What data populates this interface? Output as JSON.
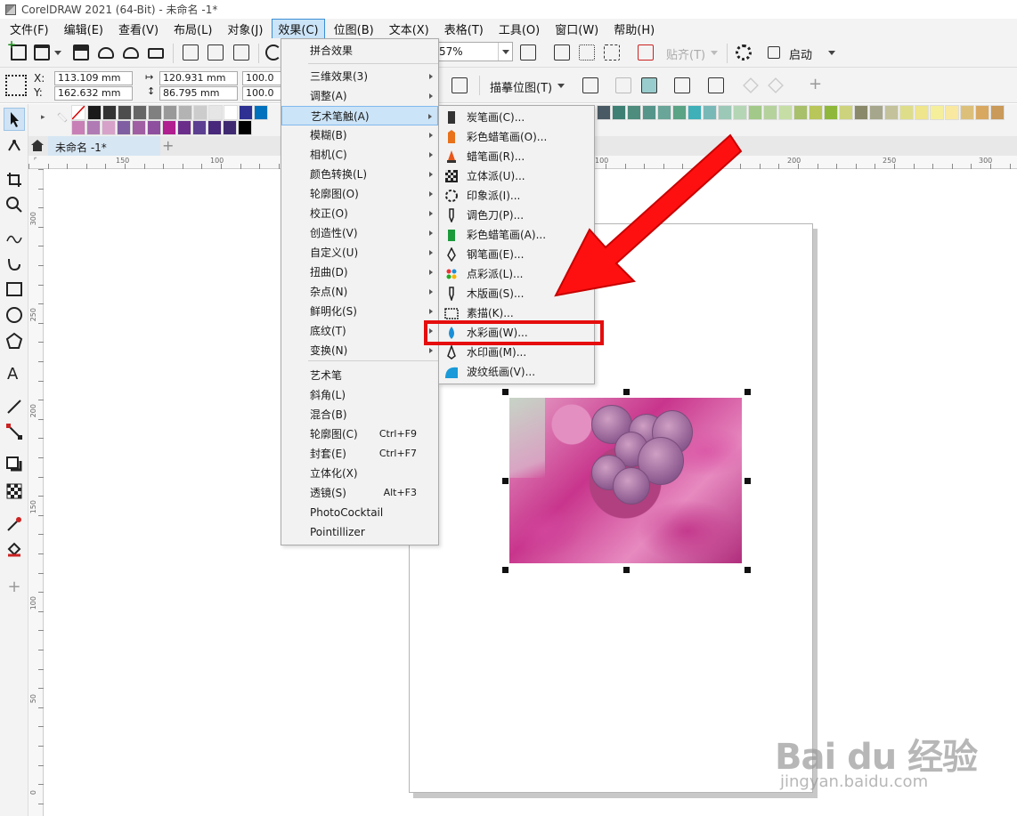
{
  "window": {
    "title": "CorelDRAW 2021 (64-Bit) - 未命名 -1*"
  },
  "menubar": {
    "items": [
      "文件(F)",
      "编辑(E)",
      "查看(V)",
      "布局(L)",
      "对象(J)",
      "效果(C)",
      "位图(B)",
      "文本(X)",
      "表格(T)",
      "工具(O)",
      "窗口(W)",
      "帮助(H)"
    ],
    "active": "效果(C)"
  },
  "toolbar": {
    "zoom": "57%",
    "align_label": "贴齐(T)",
    "launch_label": "启动"
  },
  "property_bar": {
    "x_label": "X:",
    "x_value": "113.109 mm",
    "y_label": "Y:",
    "y_value": "162.632 mm",
    "width_value": "120.931 mm",
    "height_value": "86.795 mm",
    "scale_x": "100.0",
    "scale_y": "100.0",
    "trace_label": "描摹位图(T)"
  },
  "doc_tab": {
    "label": "未命名 -1*"
  },
  "rulers": {
    "h_labels": [
      "150",
      "100",
      "100",
      "200",
      "250",
      "300"
    ],
    "v_labels": [
      "300",
      "250",
      "200",
      "150",
      "100",
      "50",
      "0"
    ]
  },
  "effects_menu": {
    "items": [
      {
        "label": "拼合效果",
        "submenu": false,
        "shortcut": ""
      },
      {
        "label": "三维效果(3)",
        "submenu": true,
        "shortcut": ""
      },
      {
        "label": "调整(A)",
        "submenu": true,
        "shortcut": ""
      },
      {
        "label": "艺术笔触(A)",
        "submenu": true,
        "shortcut": "",
        "highlighted": true
      },
      {
        "label": "模糊(B)",
        "submenu": true,
        "shortcut": ""
      },
      {
        "label": "相机(C)",
        "submenu": true,
        "shortcut": ""
      },
      {
        "label": "颜色转换(L)",
        "submenu": true,
        "shortcut": ""
      },
      {
        "label": "轮廓图(O)",
        "submenu": true,
        "shortcut": ""
      },
      {
        "label": "校正(O)",
        "submenu": true,
        "shortcut": ""
      },
      {
        "label": "创造性(V)",
        "submenu": true,
        "shortcut": ""
      },
      {
        "label": "自定义(U)",
        "submenu": true,
        "shortcut": ""
      },
      {
        "label": "扭曲(D)",
        "submenu": true,
        "shortcut": ""
      },
      {
        "label": "杂点(N)",
        "submenu": true,
        "shortcut": ""
      },
      {
        "label": "鲜明化(S)",
        "submenu": true,
        "shortcut": ""
      },
      {
        "label": "底纹(T)",
        "submenu": true,
        "shortcut": ""
      },
      {
        "label": "变换(N)",
        "submenu": true,
        "shortcut": ""
      },
      {
        "label": "艺术笔",
        "submenu": false,
        "shortcut": ""
      },
      {
        "label": "斜角(L)",
        "submenu": false,
        "shortcut": ""
      },
      {
        "label": "混合(B)",
        "submenu": false,
        "shortcut": ""
      },
      {
        "label": "轮廓图(C)",
        "submenu": false,
        "shortcut": "Ctrl+F9"
      },
      {
        "label": "封套(E)",
        "submenu": false,
        "shortcut": "Ctrl+F7"
      },
      {
        "label": "立体化(X)",
        "submenu": false,
        "shortcut": ""
      },
      {
        "label": "透镜(S)",
        "submenu": false,
        "shortcut": "Alt+F3"
      },
      {
        "label": "PhotoCocktail",
        "submenu": false,
        "shortcut": ""
      },
      {
        "label": "Pointillizer",
        "submenu": false,
        "shortcut": ""
      }
    ]
  },
  "art_submenu": {
    "items": [
      {
        "label": "炭笔画(C)...",
        "icon": "charcoal-icon"
      },
      {
        "label": "彩色蜡笔画(O)...",
        "icon": "crayon-icon"
      },
      {
        "label": "蜡笔画(R)...",
        "icon": "wax-crayon-icon"
      },
      {
        "label": "立体派(U)...",
        "icon": "cubism-icon"
      },
      {
        "label": "印象派(I)...",
        "icon": "impressionism-icon"
      },
      {
        "label": "调色刀(P)...",
        "icon": "palette-knife-icon"
      },
      {
        "label": "彩色蜡笔画(A)...",
        "icon": "pastel-icon"
      },
      {
        "label": "钢笔画(E)...",
        "icon": "pen-icon"
      },
      {
        "label": "点彩派(L)...",
        "icon": "pointillism-icon"
      },
      {
        "label": "木版画(S)...",
        "icon": "woodcut-icon"
      },
      {
        "label": "素描(K)...",
        "icon": "sketch-icon"
      },
      {
        "label": "水彩画(W)...",
        "icon": "watercolor-icon",
        "marked": true
      },
      {
        "label": "水印画(M)...",
        "icon": "watermark-pen-icon"
      },
      {
        "label": "波纹纸画(V)...",
        "icon": "wave-paper-icon"
      }
    ]
  },
  "colors": {
    "accent": "#cce4f7",
    "annotation_red": "#e50d0d",
    "palette_row1": [
      "#1a1a1a",
      "#333333",
      "#4d4d4d",
      "#666666",
      "#808080",
      "#999999",
      "#b3b3b3",
      "#cccccc",
      "#e6e6e6",
      "#ffffff",
      "#2e3192",
      "#0071bc"
    ],
    "palette_row2": [
      "#c77fb5",
      "#b07bb4",
      "#d7a2c9",
      "#7f5fa1",
      "#a05fa3",
      "#8e4f9e",
      "#b01e8f",
      "#6a2e8a",
      "#5c3f91",
      "#47287a",
      "#3f2a72",
      "#000000"
    ],
    "palette_right": [
      "#4a5a64",
      "#3e8074",
      "#4e8c7d",
      "#56958a",
      "#6aa599",
      "#5aa384",
      "#3fb0b8",
      "#78b9b8",
      "#9cc8b7",
      "#b4d6b4",
      "#a3c98a",
      "#b5d29d",
      "#c6dea5",
      "#a8c06a",
      "#b8c65a",
      "#8fb83a",
      "#cdd37c",
      "#8a8a6a",
      "#a6a68c",
      "#c4c29a",
      "#dede8a",
      "#eee58c",
      "#f5ef9c",
      "#f8e8a0",
      "#dcc07a",
      "#d8a860",
      "#c99a5a"
    ]
  },
  "watermark": {
    "logo": "Bai du 经验",
    "sub": "jingyan.baidu.com"
  }
}
